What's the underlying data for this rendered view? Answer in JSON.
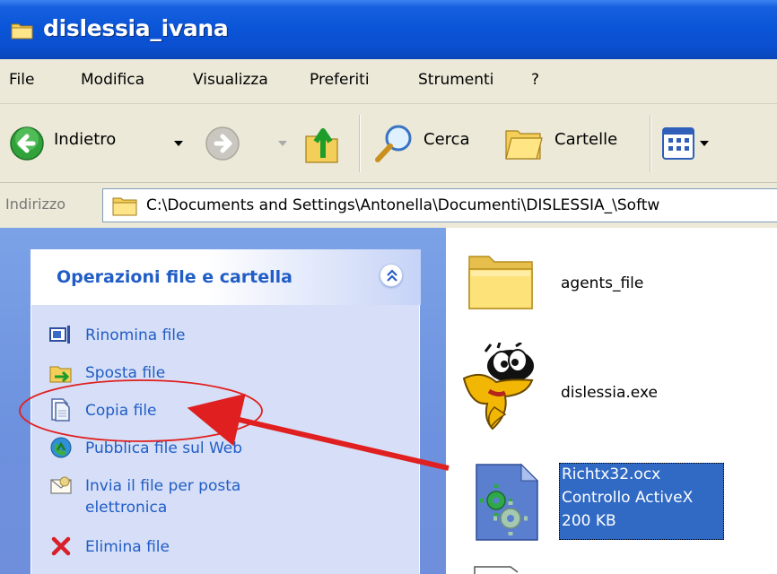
{
  "window": {
    "title": "dislessia_ivana"
  },
  "menu": {
    "items": [
      "File",
      "Modifica",
      "Visualizza",
      "Preferiti",
      "Strumenti",
      "?"
    ]
  },
  "toolbar": {
    "back_label": "Indietro",
    "search_label": "Cerca",
    "folders_label": "Cartelle"
  },
  "address": {
    "label": "Indirizzo",
    "path": "C:\\Documents and Settings\\Antonella\\Documenti\\DISLESSIA_\\Softw"
  },
  "task_panel": {
    "title": "Operazioni file e cartella",
    "tasks": [
      {
        "label": "Rinomina file",
        "icon": "rename-icon"
      },
      {
        "label": "Sposta file",
        "icon": "move-icon"
      },
      {
        "label": "Copia file",
        "icon": "copy-icon"
      },
      {
        "label": "Pubblica file sul Web",
        "icon": "publish-web-icon"
      },
      {
        "label_line1": "Invia il file per posta",
        "label_line2": "elettronica",
        "icon": "email-icon"
      },
      {
        "label": "Elimina file",
        "icon": "delete-icon"
      }
    ]
  },
  "files": [
    {
      "name": "agents_file",
      "icon": "folder-icon"
    },
    {
      "name": "dislessia.exe",
      "icon": "duck-app-icon"
    },
    {
      "name": "Richtx32.ocx",
      "type": "Controllo ActiveX",
      "size": "200 KB",
      "icon": "activex-icon",
      "selected": true
    }
  ],
  "annotation": {
    "shape": "ellipse",
    "color": "#e02020",
    "target": "Copia file",
    "from": "Richtx32.ocx"
  }
}
